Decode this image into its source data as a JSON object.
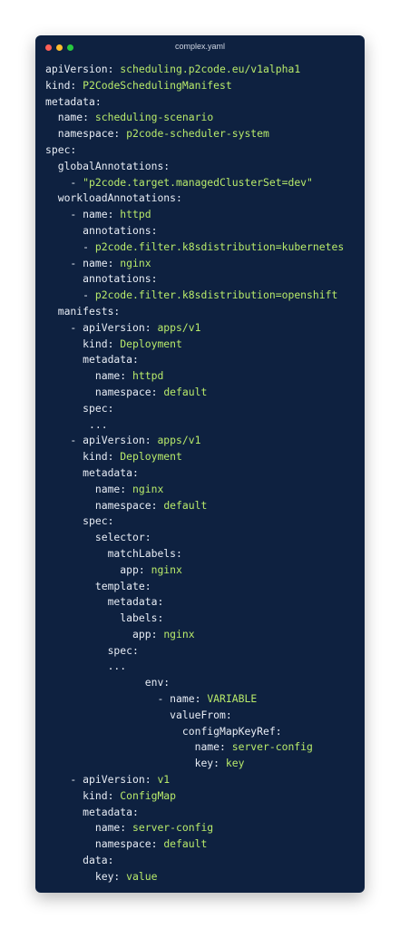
{
  "window": {
    "title": "complex.yaml"
  },
  "code": {
    "lines": [
      {
        "k": "apiVersion: ",
        "v": "scheduling.p2code.eu/v1alpha1"
      },
      {
        "k": "kind: ",
        "v": "P2CodeSchedulingManifest"
      },
      {
        "k": "metadata:",
        "v": ""
      },
      {
        "k": "  name: ",
        "v": "scheduling-scenario"
      },
      {
        "k": "  namespace: ",
        "v": "p2code-scheduler-system"
      },
      {
        "k": "spec:",
        "v": ""
      },
      {
        "k": "  globalAnnotations:",
        "v": ""
      },
      {
        "k": "    - ",
        "v": "\"p2code.target.managedClusterSet=dev\""
      },
      {
        "k": "  workloadAnnotations:",
        "v": ""
      },
      {
        "k": "    - name: ",
        "v": "httpd"
      },
      {
        "k": "      annotations:",
        "v": ""
      },
      {
        "k": "      - ",
        "v": "p2code.filter.k8sdistribution=kubernetes"
      },
      {
        "k": "    - name: ",
        "v": "nginx"
      },
      {
        "k": "      annotations:",
        "v": ""
      },
      {
        "k": "      - ",
        "v": "p2code.filter.k8sdistribution=openshift"
      },
      {
        "k": "  manifests:",
        "v": ""
      },
      {
        "k": "    - apiVersion: ",
        "v": "apps/v1"
      },
      {
        "k": "      kind: ",
        "v": "Deployment"
      },
      {
        "k": "      metadata:",
        "v": ""
      },
      {
        "k": "        name: ",
        "v": "httpd"
      },
      {
        "k": "        namespace: ",
        "v": "default"
      },
      {
        "k": "      spec:",
        "v": ""
      },
      {
        "k": "       ...",
        "v": ""
      },
      {
        "k": "    - apiVersion: ",
        "v": "apps/v1"
      },
      {
        "k": "      kind: ",
        "v": "Deployment"
      },
      {
        "k": "      metadata:",
        "v": ""
      },
      {
        "k": "        name: ",
        "v": "nginx"
      },
      {
        "k": "        namespace: ",
        "v": "default"
      },
      {
        "k": "      spec:",
        "v": ""
      },
      {
        "k": "        selector:",
        "v": ""
      },
      {
        "k": "          matchLabels:",
        "v": ""
      },
      {
        "k": "            app: ",
        "v": "nginx"
      },
      {
        "k": "        template:",
        "v": ""
      },
      {
        "k": "          metadata:",
        "v": ""
      },
      {
        "k": "            labels:",
        "v": ""
      },
      {
        "k": "              app: ",
        "v": "nginx"
      },
      {
        "k": "          spec:",
        "v": ""
      },
      {
        "k": "          ...",
        "v": ""
      },
      {
        "k": "                env:",
        "v": ""
      },
      {
        "k": "                  - name: ",
        "v": "VARIABLE"
      },
      {
        "k": "                    valueFrom:",
        "v": ""
      },
      {
        "k": "                      configMapKeyRef:",
        "v": ""
      },
      {
        "k": "                        name: ",
        "v": "server-config"
      },
      {
        "k": "                        key: ",
        "v": "key"
      },
      {
        "k": "    - apiVersion: ",
        "v": "v1"
      },
      {
        "k": "      kind: ",
        "v": "ConfigMap"
      },
      {
        "k": "      metadata:",
        "v": ""
      },
      {
        "k": "        name: ",
        "v": "server-config"
      },
      {
        "k": "        namespace: ",
        "v": "default"
      },
      {
        "k": "      data:",
        "v": ""
      },
      {
        "k": "        key: ",
        "v": "value"
      }
    ]
  }
}
